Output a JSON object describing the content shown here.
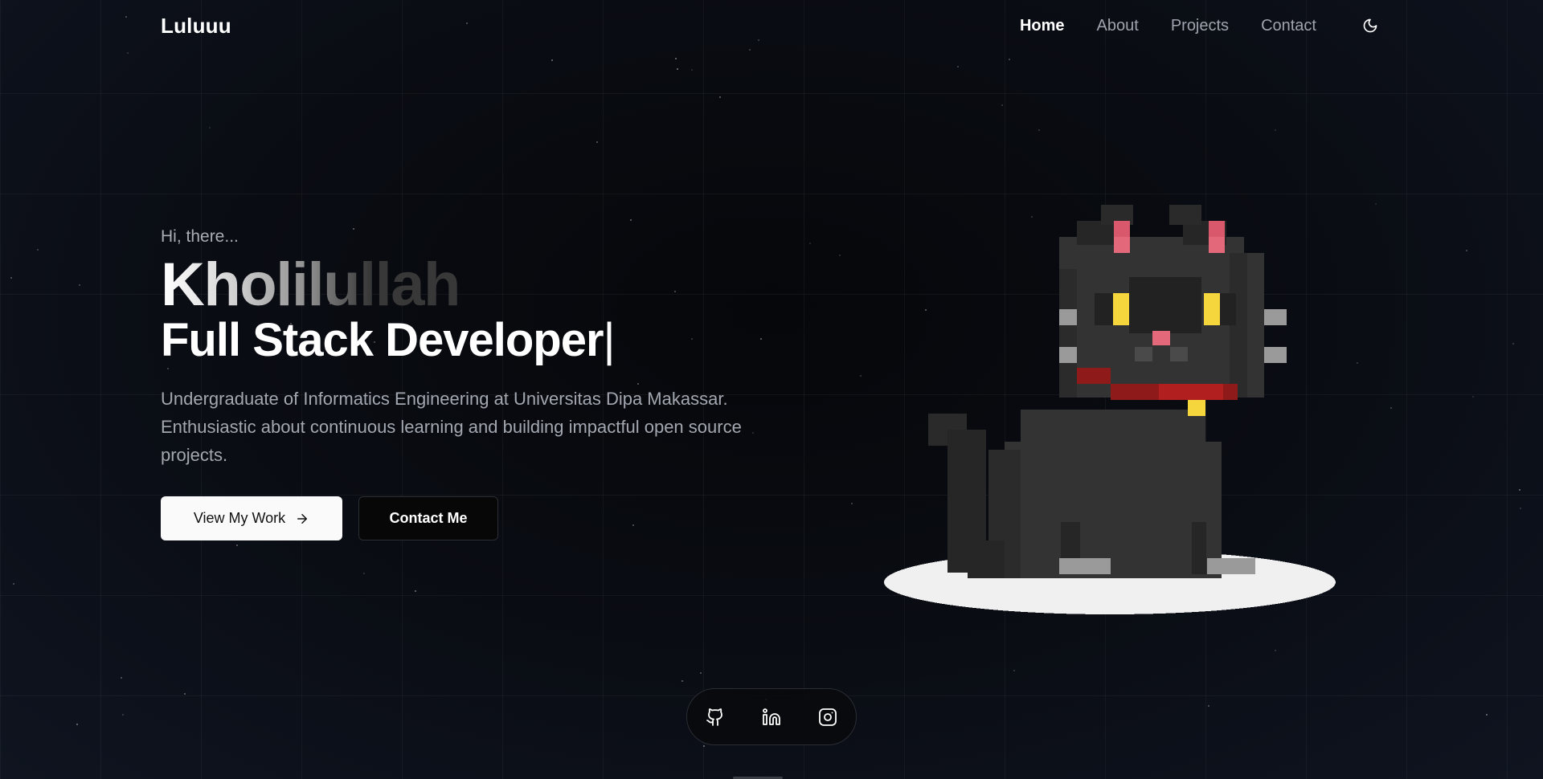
{
  "nav": {
    "logo": "Luluuu",
    "links": [
      {
        "label": "Home",
        "active": true
      },
      {
        "label": "About",
        "active": false
      },
      {
        "label": "Projects",
        "active": false
      },
      {
        "label": "Contact",
        "active": false
      }
    ],
    "theme_toggle_icon": "moon-icon"
  },
  "hero": {
    "greeting": "Hi, there...",
    "name": "Kholilullah",
    "role": "Full Stack Developer",
    "cursor": "|",
    "description": "Undergraduate of Informatics Engineering at Universitas Dipa Makassar. Enthusiastic about continuous learning and building impactful open source projects.",
    "primary_button": {
      "label": "View My Work",
      "icon": "arrow-right-icon"
    },
    "secondary_button": {
      "label": "Contact Me"
    }
  },
  "illustration": {
    "subject": "pixel-art black cat on a white platform",
    "colors": {
      "fur_dark": "#262626",
      "fur": "#333333",
      "eyes": "#f5d63d",
      "ears": "#e3687a",
      "collar": "#b21f1f",
      "bell": "#f5d63d",
      "platform": "#f0f0f0"
    }
  },
  "social": [
    {
      "name": "github",
      "icon": "github-icon"
    },
    {
      "name": "linkedin",
      "icon": "linkedin-icon"
    },
    {
      "name": "instagram",
      "icon": "instagram-icon"
    }
  ],
  "colors": {
    "background": "#0a0d14",
    "accent": "#ffffff",
    "muted_text": "#a3a7b0"
  }
}
